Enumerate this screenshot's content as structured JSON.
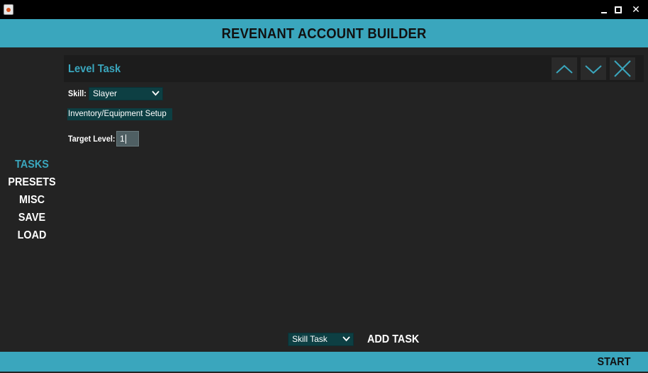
{
  "window": {
    "icon": "java-cup-icon",
    "minimize_glyph": "",
    "maximize_glyph": "",
    "close_glyph": "✕"
  },
  "header": {
    "title": "REVENANT ACCOUNT BUILDER",
    "color": "#3aa6bd"
  },
  "nav": {
    "items": [
      {
        "label": "TASKS",
        "active": true
      },
      {
        "label": "PRESETS",
        "active": false
      },
      {
        "label": "MISC",
        "active": false
      },
      {
        "label": "SAVE",
        "active": false
      },
      {
        "label": "LOAD",
        "active": false
      }
    ]
  },
  "task": {
    "title": "Level Task",
    "controls": [
      "chevron-up-icon",
      "chevron-down-icon",
      "close-icon"
    ],
    "skill_label": "Skill:",
    "skill_value": "Slayer",
    "setup_button": "Inventory/Equipment Setup",
    "target_label": "Target Level:",
    "target_value": "1"
  },
  "bottom": {
    "task_type_value": "Skill Task",
    "add_task_label": "ADD TASK"
  },
  "footer": {
    "start_label": "START"
  },
  "colors": {
    "accent": "#3aa6bd",
    "background": "#232323",
    "control_fill": "#0d3f43"
  }
}
